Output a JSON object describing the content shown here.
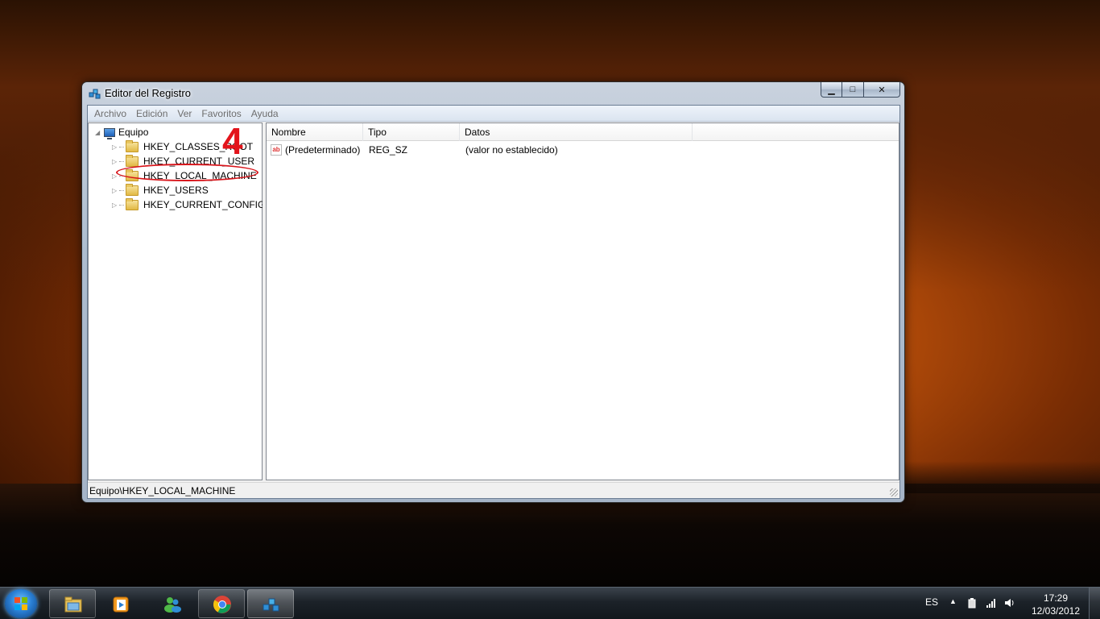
{
  "window": {
    "title": "Editor del Registro",
    "controls": {
      "minimize": "▁",
      "maximize": "□",
      "close": "✕"
    }
  },
  "menu": [
    "Archivo",
    "Edición",
    "Ver",
    "Favoritos",
    "Ayuda"
  ],
  "tree": {
    "root": "Equipo",
    "keys": [
      "HKEY_CLASSES_ROOT",
      "HKEY_CURRENT_USER",
      "HKEY_LOCAL_MACHINE",
      "HKEY_USERS",
      "HKEY_CURRENT_CONFIG"
    ],
    "expander_closed": "▷",
    "expander_open": "◢"
  },
  "annotation": {
    "step_number": "4"
  },
  "list": {
    "columns": [
      "Nombre",
      "Tipo",
      "Datos"
    ],
    "rows": [
      {
        "icon": "ab",
        "name": "(Predeterminado)",
        "type": "REG_SZ",
        "data": "(valor no establecido)"
      }
    ]
  },
  "statusbar": {
    "path": "Equipo\\HKEY_LOCAL_MACHINE"
  },
  "taskbar": {
    "language": "ES",
    "tray_arrow": "▲",
    "time": "17:29",
    "date": "12/03/2012",
    "pinned": [
      "file-explorer-icon",
      "media-player-icon",
      "messenger-icon",
      "chrome-icon",
      "regedit-icon"
    ]
  },
  "colors": {
    "annotation_red": "#e3141b",
    "selection_accent": "#3399ff"
  }
}
